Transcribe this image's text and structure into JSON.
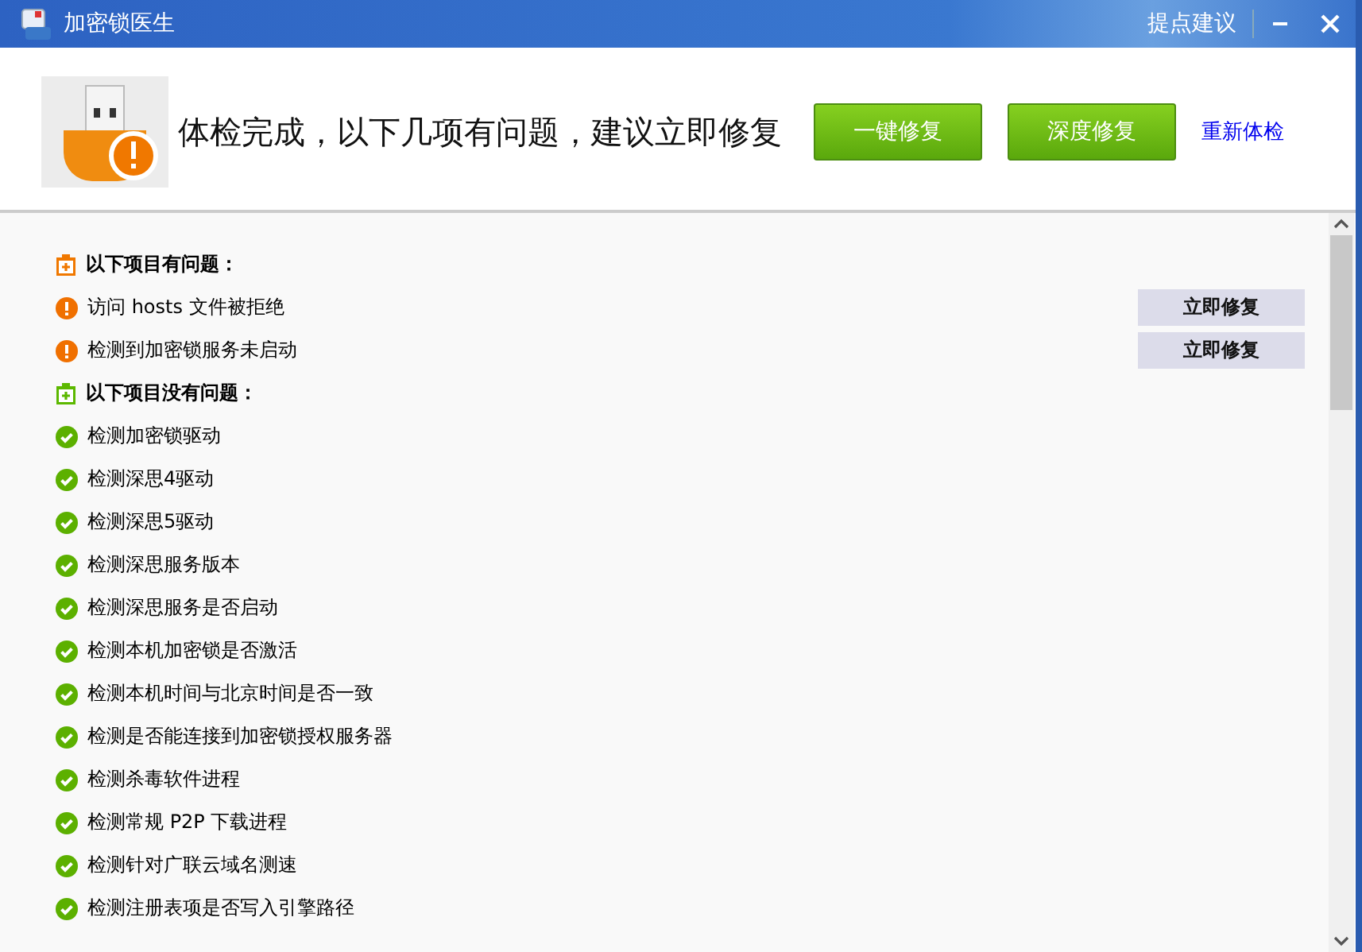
{
  "window": {
    "title": "加密锁医生",
    "feedback": "提点建议"
  },
  "header": {
    "message": "体检完成，以下几项有问题，建议立即修复",
    "buttons": [
      "一键修复",
      "深度修复"
    ],
    "link": "重新体检"
  },
  "sections": [
    {
      "kind": "problem",
      "title": "以下项目有问题：",
      "items": [
        {
          "text": "访问 hosts 文件被拒绝",
          "action": "立即修复"
        },
        {
          "text": "检测到加密锁服务未启动",
          "action": "立即修复"
        }
      ]
    },
    {
      "kind": "ok",
      "title": "以下项目没有问题：",
      "items": [
        {
          "text": "检测加密锁驱动"
        },
        {
          "text": "检测深思4驱动"
        },
        {
          "text": "检测深思5驱动"
        },
        {
          "text": "检测深思服务版本"
        },
        {
          "text": "检测深思服务是否启动"
        },
        {
          "text": "检测本机加密锁是否激活"
        },
        {
          "text": "检测本机时间与北京时间是否一致"
        },
        {
          "text": "检测是否能连接到加密锁授权服务器"
        },
        {
          "text": "检测杀毒软件进程"
        },
        {
          "text": "检测常规 P2P 下载进程"
        },
        {
          "text": "检测针对广联云域名测速"
        },
        {
          "text": "检测注册表项是否写入引擎路径"
        }
      ]
    }
  ]
}
